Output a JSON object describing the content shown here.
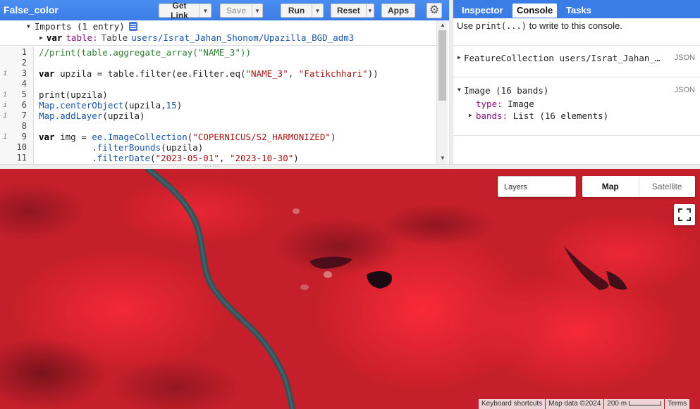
{
  "editor": {
    "title": "False_color",
    "buttons": {
      "get_link": "Get Link",
      "save": "Save",
      "run": "Run",
      "reset": "Reset",
      "apps": "Apps"
    },
    "imports": {
      "header": "Imports (1 entry)",
      "keyword": "var",
      "name": "table:",
      "type": "Table",
      "asset": "users/Israt_Jahan_Shonom/Upazilla_BGD_adm3"
    },
    "line_numbers": [
      "1",
      "2",
      "3",
      "4",
      "5",
      "6",
      "7",
      "8",
      "9",
      "10",
      "11"
    ],
    "info_markers": [
      "i",
      "i",
      "i",
      "i",
      "i"
    ],
    "code": {
      "l1": "//print(table.aggregate_array(\"NAME_3\"))",
      "l3_a": "var",
      "l3_b": " upzila = table.filter(ee.Filter.eq(",
      "l3_c": "\"NAME_3\"",
      "l3_d": ", ",
      "l3_e": "\"Fatikchhari\"",
      "l3_f": "))",
      "l5": "print(upzila)",
      "l6_a": "Map.centerObject",
      "l6_b": "(upzila,",
      "l6_c": "15",
      "l6_d": ")",
      "l7_a": "Map.addLayer",
      "l7_b": "(upzila)",
      "l9_a": "var",
      "l9_b": " img = ",
      "l9_c": "ee.ImageCollection",
      "l9_d": "(",
      "l9_e": "\"COPERNICUS/S2_HARMONIZED\"",
      "l9_f": ")",
      "l10_a": "          .filterBounds",
      "l10_b": "(upzila)",
      "l11_a": "          .filterDate",
      "l11_b": "(",
      "l11_c": "\"2023-05-01\"",
      "l11_d": ", ",
      "l11_e": "\"2023-10-30\"",
      "l11_f": ")"
    }
  },
  "right_panel": {
    "tabs": [
      "Inspector",
      "Console",
      "Tasks"
    ],
    "active_tab": "Console",
    "hint_prefix": "Use ",
    "hint_code": "print(...)",
    "hint_suffix": " to write to this console.",
    "entries": [
      {
        "text": "FeatureCollection users/Israt_Jahan_…",
        "badge": "JSON"
      },
      {
        "text": "Image (16 bands)",
        "badge": "JSON"
      }
    ],
    "image_props": {
      "type_key": "type:",
      "type_val": "Image",
      "bands_key": "bands:",
      "bands_val": "List (16 elements)"
    }
  },
  "map": {
    "layers_label": "Layers",
    "map_type": [
      "Map",
      "Satellite"
    ],
    "active_map_type": "Map",
    "attribution": {
      "shortcuts": "Keyboard shortcuts",
      "map_data": "Map data ©2024",
      "scale": "200 m",
      "terms": "Terms"
    }
  },
  "colors": {
    "accent": "#3b7de6",
    "map_base": "#c8202a",
    "river": "#3a4f55"
  },
  "icons": {
    "settings": "gear-icon",
    "docs": "document-icon",
    "fullscreen": "fullscreen-icon"
  }
}
